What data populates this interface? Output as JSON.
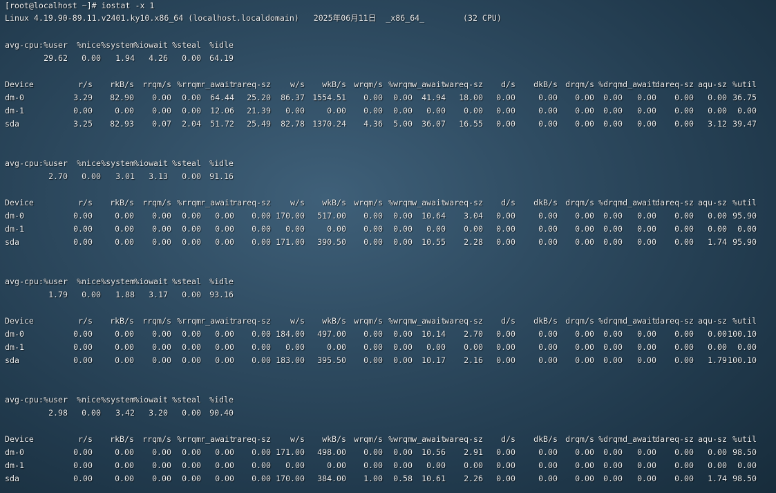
{
  "prompt": "[root@localhost ~]# iostat -x 1",
  "sysinfo": "Linux 4.19.90-89.11.v2401.ky10.x86_64 (localhost.localdomain)   2025年06月11日  _x86_64_        (32 CPU)",
  "cpu_label": "avg-cpu:",
  "cpu_headers": [
    "%user",
    "%nice",
    "%system",
    "%iowait",
    "%steal",
    "%idle"
  ],
  "device_headers": [
    "Device",
    "r/s",
    "rkB/s",
    "rrqm/s",
    "%rrqm",
    "r_await",
    "rareq-sz",
    "w/s",
    "wkB/s",
    "wrqm/s",
    "%wrqm",
    "w_await",
    "wareq-sz",
    "d/s",
    "dkB/s",
    "drqm/s",
    "%drqm",
    "d_await",
    "dareq-sz",
    "aqu-sz",
    "%util"
  ],
  "samples": [
    {
      "cpu": [
        "29.62",
        "0.00",
        "1.94",
        "4.26",
        "0.00",
        "64.19"
      ],
      "devices": [
        [
          "dm-0",
          "3.29",
          "82.90",
          "0.00",
          "0.00",
          "64.44",
          "25.20",
          "86.37",
          "1554.51",
          "0.00",
          "0.00",
          "41.94",
          "18.00",
          "0.00",
          "0.00",
          "0.00",
          "0.00",
          "0.00",
          "0.00",
          "0.00",
          "36.75"
        ],
        [
          "dm-1",
          "0.00",
          "0.00",
          "0.00",
          "0.00",
          "12.06",
          "21.39",
          "0.00",
          "0.00",
          "0.00",
          "0.00",
          "0.00",
          "0.00",
          "0.00",
          "0.00",
          "0.00",
          "0.00",
          "0.00",
          "0.00",
          "0.00",
          "0.00"
        ],
        [
          "sda",
          "3.25",
          "82.93",
          "0.07",
          "2.04",
          "51.72",
          "25.49",
          "82.78",
          "1370.24",
          "4.36",
          "5.00",
          "36.07",
          "16.55",
          "0.00",
          "0.00",
          "0.00",
          "0.00",
          "0.00",
          "0.00",
          "3.12",
          "39.47"
        ]
      ]
    },
    {
      "cpu": [
        "2.70",
        "0.00",
        "3.01",
        "3.13",
        "0.00",
        "91.16"
      ],
      "devices": [
        [
          "dm-0",
          "0.00",
          "0.00",
          "0.00",
          "0.00",
          "0.00",
          "0.00",
          "170.00",
          "517.00",
          "0.00",
          "0.00",
          "10.64",
          "3.04",
          "0.00",
          "0.00",
          "0.00",
          "0.00",
          "0.00",
          "0.00",
          "0.00",
          "95.90"
        ],
        [
          "dm-1",
          "0.00",
          "0.00",
          "0.00",
          "0.00",
          "0.00",
          "0.00",
          "0.00",
          "0.00",
          "0.00",
          "0.00",
          "0.00",
          "0.00",
          "0.00",
          "0.00",
          "0.00",
          "0.00",
          "0.00",
          "0.00",
          "0.00",
          "0.00"
        ],
        [
          "sda",
          "0.00",
          "0.00",
          "0.00",
          "0.00",
          "0.00",
          "0.00",
          "171.00",
          "390.50",
          "0.00",
          "0.00",
          "10.55",
          "2.28",
          "0.00",
          "0.00",
          "0.00",
          "0.00",
          "0.00",
          "0.00",
          "1.74",
          "95.90"
        ]
      ]
    },
    {
      "cpu": [
        "1.79",
        "0.00",
        "1.88",
        "3.17",
        "0.00",
        "93.16"
      ],
      "devices": [
        [
          "dm-0",
          "0.00",
          "0.00",
          "0.00",
          "0.00",
          "0.00",
          "0.00",
          "184.00",
          "497.00",
          "0.00",
          "0.00",
          "10.14",
          "2.70",
          "0.00",
          "0.00",
          "0.00",
          "0.00",
          "0.00",
          "0.00",
          "0.00",
          "100.10"
        ],
        [
          "dm-1",
          "0.00",
          "0.00",
          "0.00",
          "0.00",
          "0.00",
          "0.00",
          "0.00",
          "0.00",
          "0.00",
          "0.00",
          "0.00",
          "0.00",
          "0.00",
          "0.00",
          "0.00",
          "0.00",
          "0.00",
          "0.00",
          "0.00",
          "0.00"
        ],
        [
          "sda",
          "0.00",
          "0.00",
          "0.00",
          "0.00",
          "0.00",
          "0.00",
          "183.00",
          "395.50",
          "0.00",
          "0.00",
          "10.17",
          "2.16",
          "0.00",
          "0.00",
          "0.00",
          "0.00",
          "0.00",
          "0.00",
          "1.79",
          "100.10"
        ]
      ]
    },
    {
      "cpu": [
        "2.98",
        "0.00",
        "3.42",
        "3.20",
        "0.00",
        "90.40"
      ],
      "devices": [
        [
          "dm-0",
          "0.00",
          "0.00",
          "0.00",
          "0.00",
          "0.00",
          "0.00",
          "171.00",
          "498.00",
          "0.00",
          "0.00",
          "10.56",
          "2.91",
          "0.00",
          "0.00",
          "0.00",
          "0.00",
          "0.00",
          "0.00",
          "0.00",
          "98.50"
        ],
        [
          "dm-1",
          "0.00",
          "0.00",
          "0.00",
          "0.00",
          "0.00",
          "0.00",
          "0.00",
          "0.00",
          "0.00",
          "0.00",
          "0.00",
          "0.00",
          "0.00",
          "0.00",
          "0.00",
          "0.00",
          "0.00",
          "0.00",
          "0.00",
          "0.00"
        ],
        [
          "sda",
          "0.00",
          "0.00",
          "0.00",
          "0.00",
          "0.00",
          "0.00",
          "170.00",
          "384.00",
          "1.00",
          "0.58",
          "10.61",
          "2.26",
          "0.00",
          "0.00",
          "0.00",
          "0.00",
          "0.00",
          "0.00",
          "1.74",
          "98.50"
        ]
      ]
    }
  ]
}
